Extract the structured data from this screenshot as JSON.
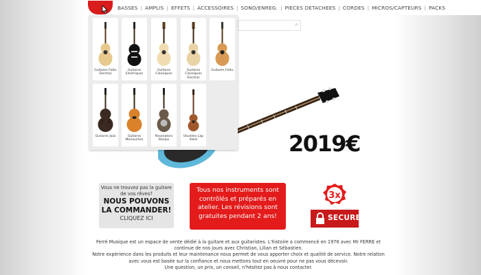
{
  "nav": {
    "items": [
      "BASSES",
      "AMPLIS",
      "EFFETS",
      "ACCESSOIRES",
      "SONO/ENREG.",
      "PIECES DETACHEES",
      "CORDES",
      "MICROS/CAPTEURS",
      "PACKS"
    ]
  },
  "dropdown": {
    "tiles": [
      {
        "label": "Guitares Folks Electros",
        "icon": "folk-electro-guitar-icon"
      },
      {
        "label": "Guitares Electriques",
        "icon": "electric-guitar-icon"
      },
      {
        "label": "Guitares Classiques",
        "icon": "classical-guitar-icon"
      },
      {
        "label": "Guitares Classiques Electros",
        "icon": "classical-electro-guitar-icon"
      },
      {
        "label": "Guitares Folks",
        "icon": "folk-guitar-icon"
      },
      {
        "label": "Guitares Jazz",
        "icon": "jazz-guitar-icon"
      },
      {
        "label": "Guitares Manouches",
        "icon": "manouche-guitar-icon"
      },
      {
        "label": "Resonators Banjos",
        "icon": "resonator-icon"
      },
      {
        "label": "Ukuleles Lap Steel",
        "icon": "ukulele-icon"
      }
    ]
  },
  "hero": {
    "price": "2019€"
  },
  "promo": {
    "line1": "Vous ne trouvez pas la guitare de vos rêves?",
    "line2": "NOUS POUVONS LA COMMANDER!",
    "line3": "CLIQUEZ ICI"
  },
  "info": {
    "text": "Tous nos instruments sont contrôlés et préparés en atelier. Les révisions sont gratuites pendant 2 ans!"
  },
  "badges": {
    "payment": "3x",
    "secure": "SECURE"
  },
  "footer": {
    "line1": "Ferré Musique est un espace de vente dédié à la guitare et aux guitaristes. L'histoire a commencé en 1976 avec Mr FERRE et continue de nos jours avec Christian, Lilian et Sébastien.",
    "line2": "Notre expérience dans les produits et leur maintenance nous permet de vous apporter choix et qualité de service. Notre relation avec vous est basée sur la confiance et nous mettons tout en oeuvre pour ne pas vous décevoir.",
    "line3": "Une question, un prix, un conseil, n'hésitez pas à nous contacter."
  },
  "colors": {
    "accent": "#e31b1b",
    "dropdown_bg": "#ececec"
  }
}
